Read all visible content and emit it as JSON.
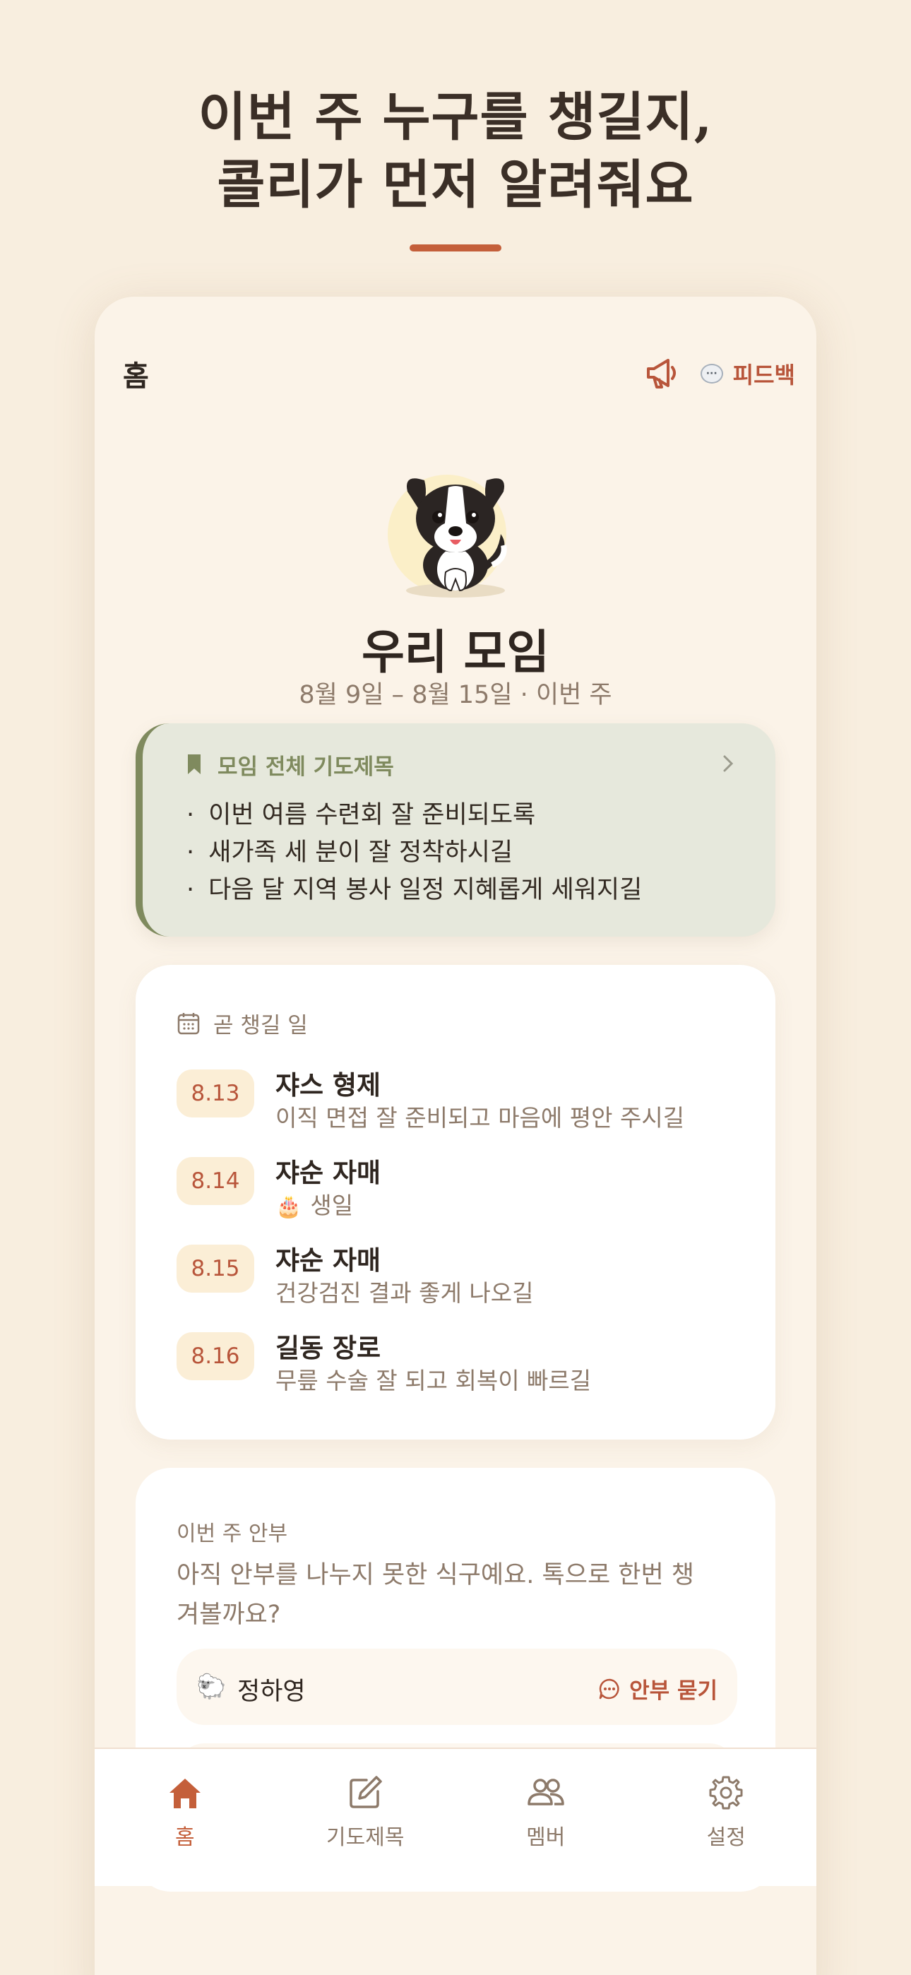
{
  "headline": {
    "line1": "이번 주 누구를 챙길지,",
    "line2": "콜리가 먼저 알려줘요"
  },
  "topbar": {
    "title": "홈",
    "feedback_label": "피드백",
    "feedback_bubble": "···"
  },
  "group": {
    "name": "우리 모임",
    "date_range": "8월 9일 – 8월 15일 · 이번 주"
  },
  "prayer_topics": {
    "title": "모임 전체 기도제목",
    "items": [
      "이번 여름 수련회 잘 준비되도록",
      "새가족 세 분이 잘 정착하시길",
      "다음 달 지역 봉사 일정 지혜롭게 세워지길"
    ]
  },
  "upcoming": {
    "title": "곧 챙길 일",
    "events": [
      {
        "date": "8.13",
        "name": "쟈스 형제",
        "note": "이직 면접 잘 준비되고 마음에 평안 주시길",
        "cake": ""
      },
      {
        "date": "8.14",
        "name": "쟈순 자매",
        "note": "생일",
        "cake": "🎂"
      },
      {
        "date": "8.15",
        "name": "쟈순 자매",
        "note": "건강검진 결과 좋게 나오길",
        "cake": ""
      },
      {
        "date": "8.16",
        "name": "길동 장로",
        "note": "무릎 수술 잘 되고 회복이 빠르길",
        "cake": ""
      }
    ]
  },
  "greeting": {
    "label": "이번 주 안부",
    "description": "아직 안부를 나누지 못한 식구예요. 톡으로 한번 챙겨볼까요?",
    "members": [
      {
        "icon": "🐑",
        "name": "정하영",
        "action": "안부 묻기"
      }
    ]
  },
  "tabs": [
    {
      "label": "홈",
      "icon": "home-icon",
      "active": true
    },
    {
      "label": "기도제목",
      "icon": "edit-icon",
      "active": false
    },
    {
      "label": "멤버",
      "icon": "members-icon",
      "active": false
    },
    {
      "label": "설정",
      "icon": "gear-icon",
      "active": false
    }
  ],
  "colors": {
    "background": "#f8eedf",
    "accent": "#c45f3a",
    "olive": "#7f8a5e",
    "text_muted": "#8d7a6a"
  }
}
